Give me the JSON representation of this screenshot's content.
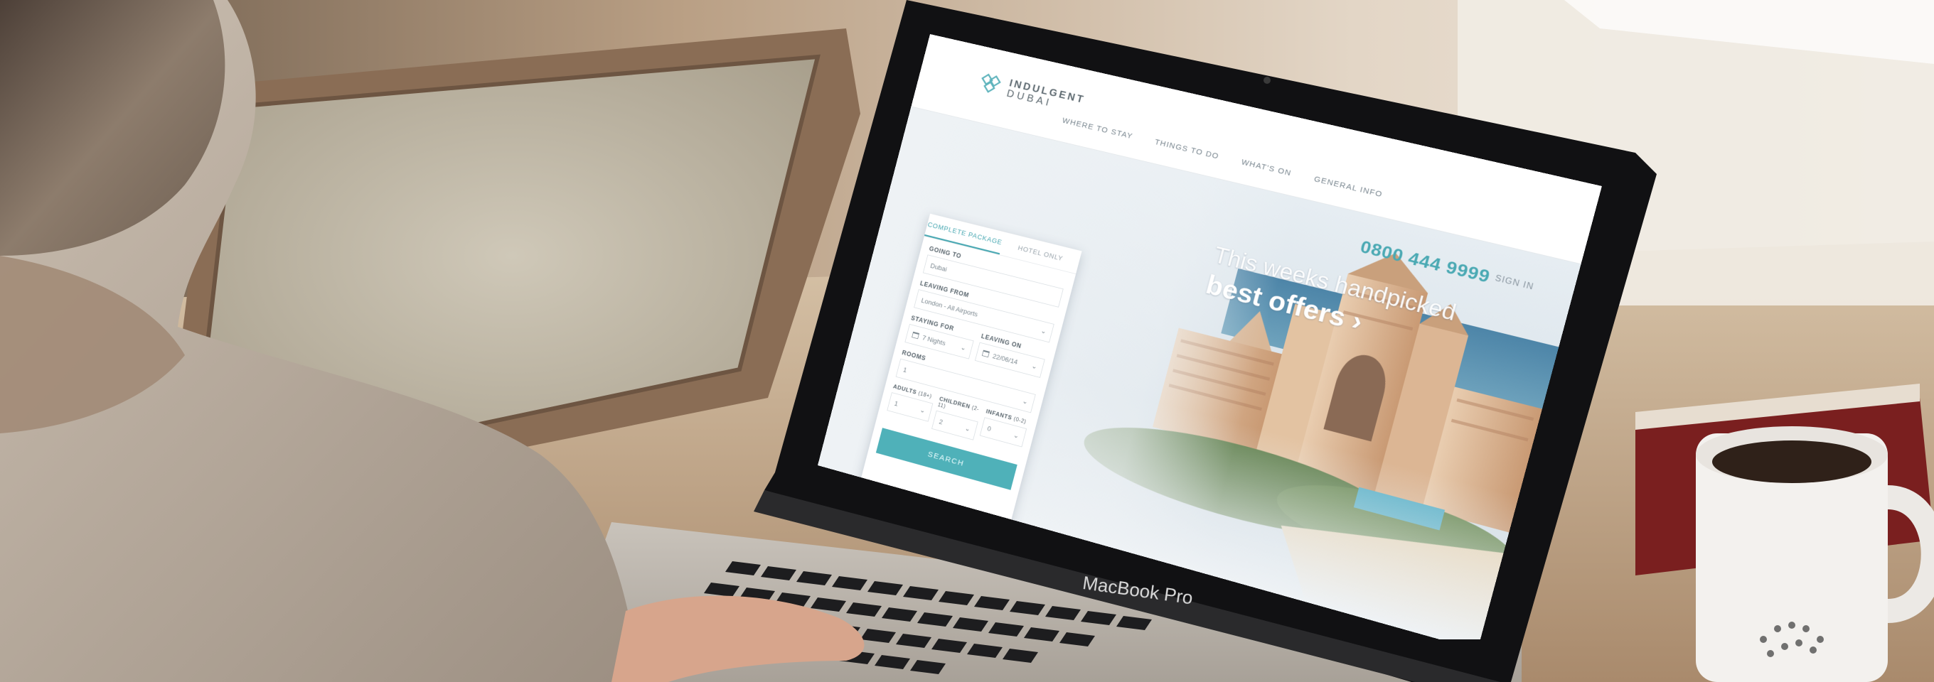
{
  "site": {
    "logo_line1": "INDULGENT",
    "logo_line2": "DUBAI",
    "nav": [
      "WHERE TO STAY",
      "THINGS TO DO",
      "WHAT'S ON",
      "GENERAL INFO"
    ],
    "phone": "0800 444 9999",
    "sign_in": "SIGN IN"
  },
  "hero": {
    "line1": "This weeks handpicked",
    "line2": "best offers ›"
  },
  "booking": {
    "tabs": [
      "COMPLETE PACKAGE",
      "HOTEL ONLY"
    ],
    "going_to_label": "GOING TO",
    "going_to_value": "Dubai",
    "leaving_from_label": "LEAVING FROM",
    "leaving_from_value": "London - All Airports",
    "staying_for_label": "STAYING FOR",
    "staying_for_value": "7 Nights",
    "leaving_on_label": "LEAVING ON",
    "leaving_on_value": "22/06/14",
    "rooms_label": "ROOMS",
    "rooms_value": "1",
    "adults_label": "ADULTS",
    "adults_note": "(18+)",
    "adults_value": "1",
    "children_label": "CHILDREN",
    "children_note": "(2-11)",
    "children_value": "2",
    "infants_label": "INFANTS",
    "infants_note": "(0-2)",
    "infants_value": "0",
    "search_label": "SEARCH"
  },
  "device": {
    "brand": "MacBook Pro"
  },
  "colors": {
    "accent": "#4aa9b3",
    "search_button": "#4fb1b9"
  }
}
